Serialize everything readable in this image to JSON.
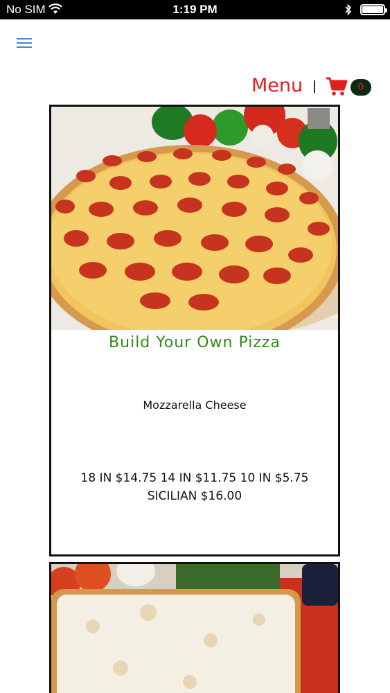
{
  "status_bar": {
    "carrier": "No SIM",
    "time": "1:19 PM"
  },
  "header": {
    "menu_label": "Menu",
    "cart_count": "0"
  },
  "colors": {
    "accent_red": "#e01f1f",
    "title_green": "#2e8b1a",
    "hamburger_blue": "#4a86d4",
    "badge_dark": "#0c2a14"
  },
  "products": [
    {
      "title": "Build Your Own Pizza",
      "description": "Mozzarella Cheese",
      "prices_line1": "18 IN $14.75  14 IN $11.75  10 IN $5.75",
      "prices_line2": "SICILIAN $16.00"
    }
  ]
}
